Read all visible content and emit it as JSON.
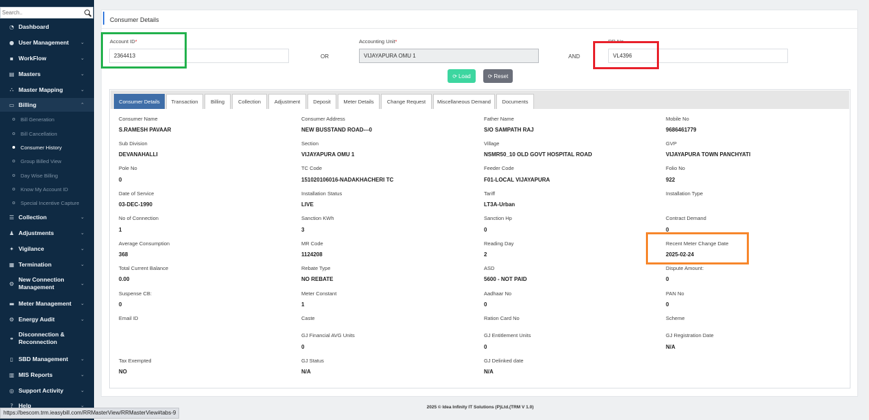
{
  "sidebar": {
    "search_placeholder": "Search..",
    "menu": [
      {
        "label": "Dashboard",
        "icon": "dashboard-icon",
        "glyph": "◔",
        "chevron": ""
      },
      {
        "label": "User Management",
        "icon": "user-icon",
        "glyph": "●",
        "chevron": "⌄"
      },
      {
        "label": "WorkFlow",
        "icon": "workflow-icon",
        "glyph": "▪",
        "chevron": "⌄"
      },
      {
        "label": "Masters",
        "icon": "masters-icon",
        "glyph": "▤",
        "chevron": "⌄"
      },
      {
        "label": "Master Mapping",
        "icon": "mapping-icon",
        "glyph": "⛬",
        "chevron": "⌄"
      },
      {
        "label": "Billing",
        "icon": "monitor-icon",
        "glyph": "▭",
        "chevron": "⌃"
      },
      {
        "label": "Collection",
        "icon": "collection-icon",
        "glyph": "☰",
        "chevron": "⌄"
      },
      {
        "label": "Adjustments",
        "icon": "adjustments-icon",
        "glyph": "♟",
        "chevron": "⌄"
      },
      {
        "label": "Vigilance",
        "icon": "vigilance-icon",
        "glyph": "✦",
        "chevron": "⌄"
      },
      {
        "label": "Termination",
        "icon": "termination-icon",
        "glyph": "▦",
        "chevron": "⌄"
      },
      {
        "label": "New Connection Management",
        "icon": "gear-icon",
        "glyph": "⚙",
        "chevron": "⌄"
      },
      {
        "label": "Meter Management",
        "icon": "meter-icon",
        "glyph": "▬",
        "chevron": "⌄"
      },
      {
        "label": "Energy Audit",
        "icon": "gears-icon",
        "glyph": "⚙",
        "chevron": "⌄"
      },
      {
        "label": "Disconnection & Reconnection",
        "icon": "link-icon",
        "glyph": "⚭",
        "chevron": ""
      },
      {
        "label": "SBD Management",
        "icon": "sbd-icon",
        "glyph": "▯",
        "chevron": "⌄"
      },
      {
        "label": "MIS Reports",
        "icon": "chart-icon",
        "glyph": "▥",
        "chevron": "⌄"
      },
      {
        "label": "Support Activity",
        "icon": "support-icon",
        "glyph": "◎",
        "chevron": "⌄"
      },
      {
        "label": "Help",
        "icon": "help-icon",
        "glyph": "?",
        "chevron": "⌄"
      }
    ],
    "submenu": [
      "Bill Generation",
      "Bill Cancellation",
      "Consumer History",
      "Group Billed View",
      "Day Wise Billing",
      "Know My Account ID",
      "Special Incentive Capture"
    ]
  },
  "page": {
    "title": "Consumer Details",
    "account_id_label": "Account ID",
    "account_id_value": "2364413",
    "or_label": "OR",
    "accounting_unit_label": "Accounting Unit",
    "accounting_unit_value": "VIJAYAPURA OMU 1",
    "and_label": "AND",
    "rr_label": "RR No",
    "rr_value": "VL4396",
    "required_mark": "*",
    "load_label": "Load",
    "reset_label": "Reset"
  },
  "tabs": [
    "Consumer Details",
    "Transaction",
    "Billing",
    "Collection",
    "Adjustment",
    "Deposit",
    "Meter Details",
    "Change Request",
    "Miscellaneous Demand",
    "Documents"
  ],
  "details": [
    {
      "label": "Consumer Name",
      "value": "S.RAMESH PAVAAR"
    },
    {
      "label": "Consumer Address",
      "value": "NEW BUSSTAND ROAD---0"
    },
    {
      "label": "Father Name",
      "value": "S/O SAMPATH RAJ"
    },
    {
      "label": "Mobile No",
      "value": "9686461779"
    },
    {
      "label": "Sub Division",
      "value": "DEVANAHALLI"
    },
    {
      "label": "Section",
      "value": "VIJAYAPURA OMU 1"
    },
    {
      "label": "Village",
      "value": "NSMR50_10 OLD GOVT HOSPITAL ROAD"
    },
    {
      "label": "GVP",
      "value": "VIJAYAPURA TOWN PANCHYATI"
    },
    {
      "label": "Pole No",
      "value": "0"
    },
    {
      "label": "TC Code",
      "value": "151020106016-NADAKHACHERI TC"
    },
    {
      "label": "Feeder Code",
      "value": "F01-LOCAL VIJAYAPURA"
    },
    {
      "label": "Folio No",
      "value": "922"
    },
    {
      "label": "Date of Service",
      "value": "03-DEC-1990"
    },
    {
      "label": "Installation Status",
      "value": "LIVE"
    },
    {
      "label": "Tariff",
      "value": "LT3A-Urban"
    },
    {
      "label": "Installation Type",
      "value": ""
    },
    {
      "label": "No of Connection",
      "value": "1"
    },
    {
      "label": "Sanction KWh",
      "value": "3"
    },
    {
      "label": "Sanction Hp",
      "value": "0"
    },
    {
      "label": "Contract Demand",
      "value": "0"
    },
    {
      "label": "Average Consumption",
      "value": "368"
    },
    {
      "label": "MR Code",
      "value": "1124208"
    },
    {
      "label": "Reading Day",
      "value": "2"
    },
    {
      "label": "Recent Meter Change Date",
      "value": "2025-02-24"
    },
    {
      "label": "Total Current Balance",
      "value": "0.00"
    },
    {
      "label": "Rebate Type",
      "value": "NO REBATE"
    },
    {
      "label": "ASD",
      "value": "5600 - NOT PAID"
    },
    {
      "label": "Dispute Amount:",
      "value": "0"
    },
    {
      "label": "Suspense CB:",
      "value": "0"
    },
    {
      "label": "Meter Constant",
      "value": "1"
    },
    {
      "label": "Aadhaar No",
      "value": "0"
    },
    {
      "label": "PAN No",
      "value": "0"
    },
    {
      "label": "Email ID",
      "value": ""
    },
    {
      "label": "Caste",
      "value": ""
    },
    {
      "label": "Ration Card No",
      "value": ""
    },
    {
      "label": "Scheme",
      "value": ""
    },
    {
      "label": "GJ Financial AVG Units",
      "value": "0"
    },
    {
      "label": "GJ Entitlement Units",
      "value": "0"
    },
    {
      "label": "GJ Registration Date",
      "value": "N/A"
    },
    {
      "label": "Tax Exempted",
      "value": "NO"
    },
    {
      "label": "GJ Status",
      "value": "N/A"
    },
    {
      "label": "GJ Delinked date",
      "value": "N/A"
    }
  ],
  "footer": "2025 © Idea Infinity IT Solutions (P)Ltd.(TRM V 1.0)",
  "status_url": "https://bescom.trm.ieasybill.com/RRMasterView/RRMasterView#tabs-9",
  "highlight_colors": {
    "green": "#22b14c",
    "red": "#e8202a",
    "orange": "#f7862b"
  }
}
